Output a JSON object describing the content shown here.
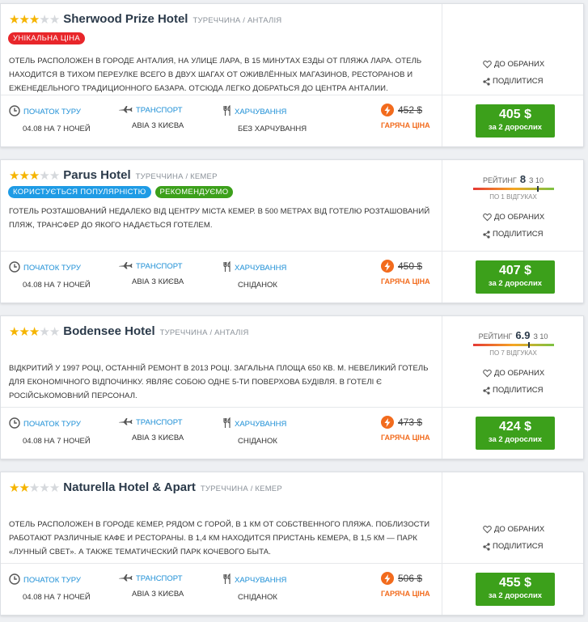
{
  "labels": {
    "favorite": "ДО ОБРАНИХ",
    "share": "ПОДІЛИТИСЯ",
    "tour_start": "ПОЧАТОК ТУРУ",
    "transport": "ТРАНСПОРТ",
    "meals": "ХАРЧУВАННЯ",
    "hot_price": "ГАРЯЧА ЦІНА",
    "rating_label": "РЕЙТИНГ",
    "rating_scale": "З 10",
    "price_sub": "за 2 дорослих"
  },
  "colors": {
    "accent_link": "#1d8fd6",
    "price_button": "#3ca01b",
    "hot": "#f26b1d",
    "star": "#f5b400",
    "badge_red": "#e8262a",
    "badge_blue": "#1e9be5",
    "badge_green": "#3ca01b"
  },
  "hotels": [
    {
      "stars": 3,
      "name": "Sherwood Prize Hotel",
      "location": "ТУРЕЧЧИНА / АНТАЛІЯ",
      "badges": [
        {
          "text": "УНІКАЛЬНА ЦІНА",
          "color": "red"
        }
      ],
      "description": "ОТЕЛЬ РАСПОЛОЖЕН В ГОРОДЕ АНТАЛИЯ, НА УЛИЦЕ ЛАРА, В 15 МИНУТАХ ЕЗДЫ ОТ ПЛЯЖА ЛАРА. ОТЕЛЬ НАХОДИТСЯ В ТИХОМ ПЕРЕУЛКЕ ВСЕГО В ДВУХ ШАГАХ ОТ ОЖИВЛЁННЫХ МАГАЗИНОВ, РЕСТОРАНОВ И ЕЖЕНЕДЕЛЬНОГО ТРАДИЦИОННОГО БАЗАРА. ОТСЮДА ЛЕГКО ДОБРАТЬСЯ ДО ЦЕНТРА АНТАЛИИ.",
      "rating": null,
      "tour_start": "04.08 НА 7 НОЧЕЙ",
      "transport": "АВІА З КИЄВА",
      "meals": "БЕЗ ХАРЧУВАННЯ",
      "old_price": "452 $",
      "price": "405 $"
    },
    {
      "stars": 3,
      "name": "Parus Hotel",
      "location": "ТУРЕЧЧИНА / КЕМЕР",
      "badges": [
        {
          "text": "КОРИСТУЄТЬСЯ ПОПУЛЯРНІСТЮ",
          "color": "blue"
        },
        {
          "text": "РЕКОМЕНДУЄМО",
          "color": "green"
        }
      ],
      "description": "ГОТЕЛЬ РОЗТАШОВАНИЙ НЕДАЛЕКО ВІД ЦЕНТРУ МІСТА КЕМЕР. В 500 МЕТРАХ ВІД ГОТЕЛЮ РОЗТАШОВАНИЙ ПЛЯЖ, ТРАНСФЕР ДО ЯКОГО НАДАЄТЬСЯ ГОТЕЛЕМ.",
      "rating": {
        "value": "8",
        "numeric": 8,
        "reviews": "ПО 1 ВІДГУКАХ"
      },
      "tour_start": "04.08 НА 7 НОЧЕЙ",
      "transport": "АВІА З КИЄВА",
      "meals": "СНІДАНОК",
      "old_price": "450 $",
      "price": "407 $"
    },
    {
      "stars": 3,
      "name": "Bodensee Hotel",
      "location": "ТУРЕЧЧИНА / АНТАЛІЯ",
      "badges": [],
      "description": "ВІДКРИТИЙ У 1997 РОЦІ, ОСТАННІЙ РЕМОНТ В 2013 РОЦІ. ЗАГАЛЬНА ПЛОЩА 650 КВ. М. НЕВЕЛИКИЙ ГОТЕЛЬ ДЛЯ ЕКОНОМІЧНОГО ВІДПОЧИНКУ. ЯВЛЯЄ СОБОЮ ОДНЕ 5-ТИ ПОВЕРХОВА БУДІВЛЯ. В ГОТЕЛІ Є РОСІЙСЬКОМОВНИЙ ПЕРСОНАЛ.",
      "rating": {
        "value": "6.9",
        "numeric": 6.9,
        "reviews": "ПО 7 ВІДГУКАХ"
      },
      "tour_start": "04.08 НА 7 НОЧЕЙ",
      "transport": "АВІА З КИЄВА",
      "meals": "СНІДАНОК",
      "old_price": "473 $",
      "price": "424 $"
    },
    {
      "stars": 2,
      "name": "Naturella Hotel & Apart",
      "location": "ТУРЕЧЧИНА / КЕМЕР",
      "badges": [],
      "description": "ОТЕЛЬ РАСПОЛОЖЕН В ГОРОДЕ КЕМЕР, РЯДОМ С ГОРОЙ, В 1 КМ ОТ СОБСТВЕННОГО ПЛЯЖА. ПОБЛИЗОСТИ РАБОТАЮТ РАЗЛИЧНЫЕ КАФЕ И РЕСТОРАНЫ. В 1,4 КМ НАХОДИТСЯ ПРИСТАНЬ КЕМЕРА, В 1,5 КМ — ПАРК «ЛУННЫЙ СВЕТ». А ТАКЖЕ ТЕМАТИЧЕСКИЙ ПАРК КОЧЕВОГО БЫТА.",
      "rating": null,
      "tour_start": "04.08 НА 7 НОЧЕЙ",
      "transport": "АВІА З КИЄВА",
      "meals": "СНІДАНОК",
      "old_price": "506 $",
      "price": "455 $"
    }
  ]
}
